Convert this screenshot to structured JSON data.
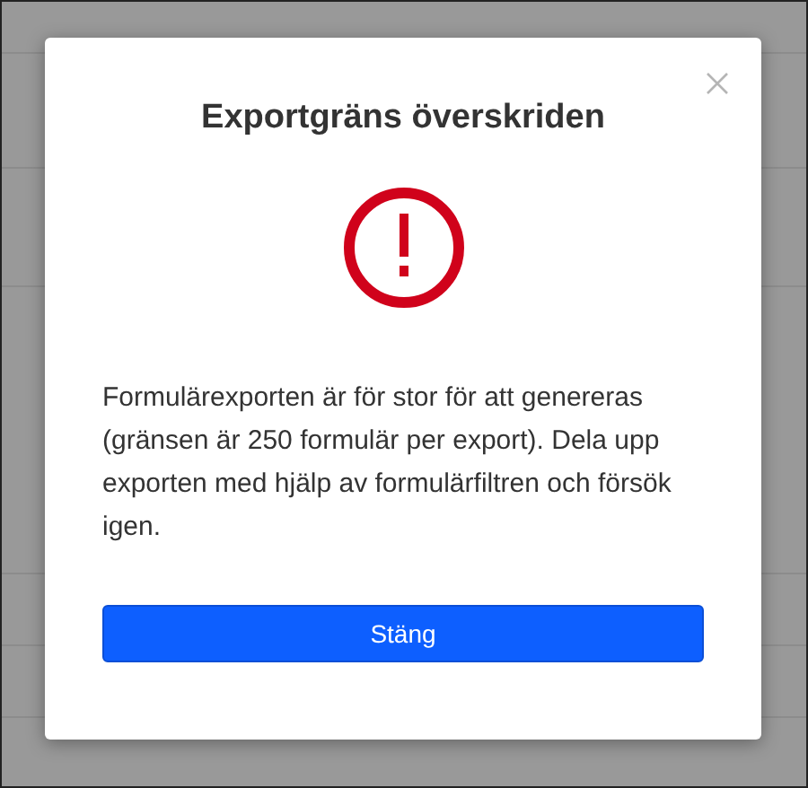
{
  "dialog": {
    "title": "Exportgräns överskriden",
    "message": "Formulärexporten är för stor för att genereras (gränsen är 250 formulär per export). Dela upp exporten med hjälp av formulärfiltren och försök igen.",
    "button": "Stäng"
  }
}
